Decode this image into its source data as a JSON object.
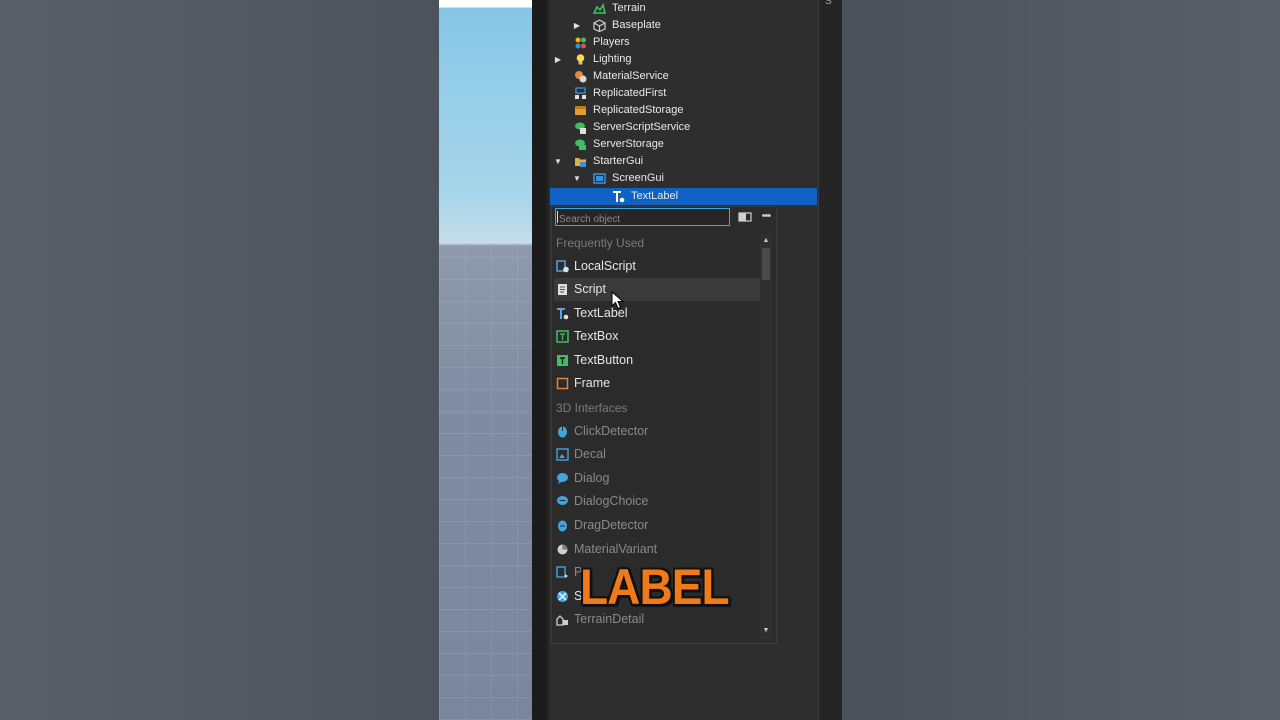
{
  "explorer": {
    "rows": [
      {
        "label": "Terrain",
        "icon": "terrain-icon",
        "color": "#3fbf5f"
      },
      {
        "label": "Baseplate",
        "icon": "part-icon",
        "color": "#d0d0d0"
      },
      {
        "label": "Players",
        "icon": "players-icon",
        "color": "#f4b400"
      },
      {
        "label": "Lighting",
        "icon": "lightbulb-icon",
        "color": "#ffd84a"
      },
      {
        "label": "MaterialService",
        "icon": "material-icon",
        "color": "#e08a3c"
      },
      {
        "label": "ReplicatedFirst",
        "icon": "replicated-first-icon",
        "color": "#3f8fd8"
      },
      {
        "label": "ReplicatedStorage",
        "icon": "replicated-storage-icon",
        "color": "#e0a030"
      },
      {
        "label": "ServerScriptService",
        "icon": "server-script-icon",
        "color": "#3fbf5f"
      },
      {
        "label": "ServerStorage",
        "icon": "server-storage-icon",
        "color": "#3fbf5f"
      },
      {
        "label": "StarterGui",
        "icon": "folder-icon",
        "color": "#e0b040"
      },
      {
        "label": "ScreenGui",
        "icon": "screen-gui-icon",
        "color": "#3f8fd8"
      },
      {
        "label": "TextLabel",
        "icon": "text-label-icon",
        "color": "#ffffff"
      }
    ]
  },
  "popup": {
    "search_placeholder": "Search object",
    "sections": {
      "frequent": "Frequently Used",
      "interfaces": "3D Interfaces"
    },
    "frequent_items": [
      {
        "label": "LocalScript",
        "icon": "local-script-icon"
      },
      {
        "label": "Script",
        "icon": "script-icon"
      },
      {
        "label": "TextLabel",
        "icon": "text-label-icon"
      },
      {
        "label": "TextBox",
        "icon": "text-box-icon"
      },
      {
        "label": "TextButton",
        "icon": "text-button-icon"
      },
      {
        "label": "Frame",
        "icon": "frame-icon"
      }
    ],
    "interface_items": [
      {
        "label": "ClickDetector",
        "icon": "click-detector-icon"
      },
      {
        "label": "Decal",
        "icon": "decal-icon"
      },
      {
        "label": "Dialog",
        "icon": "dialog-icon"
      },
      {
        "label": "DialogChoice",
        "icon": "dialog-choice-icon"
      },
      {
        "label": "DragDetector",
        "icon": "drag-detector-icon"
      },
      {
        "label": "MaterialVariant",
        "icon": "material-variant-icon"
      },
      {
        "label": "P",
        "icon": "proximity-icon"
      },
      {
        "label": "S",
        "icon": "surface-icon"
      },
      {
        "label": "TerrainDetail",
        "icon": "terrain-detail-icon"
      }
    ]
  },
  "overlay": {
    "caption": "LABEL"
  },
  "colors": {
    "selection": "#0f62c4",
    "caption": "#f07a1a",
    "search_border": "#3fa6e0"
  }
}
